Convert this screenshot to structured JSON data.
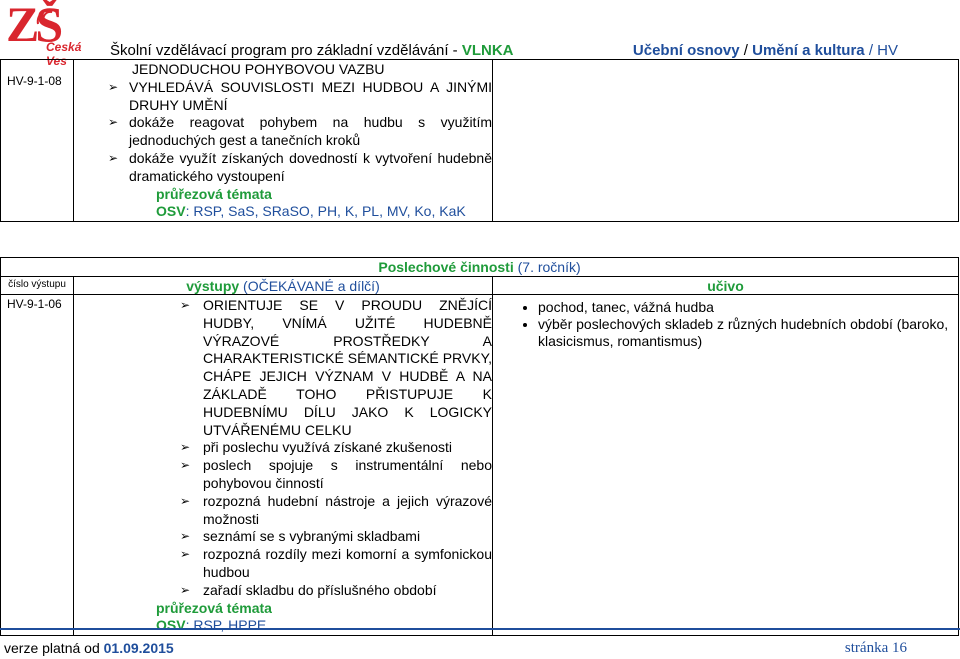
{
  "header": {
    "logo_text": "ZŠ",
    "logo_sub": "Česká Ves",
    "program_label": "Školní vzdělávací program pro základní vzdělávání - ",
    "program_name": "VLNKA",
    "curriculum_a": "Učební osnovy",
    "sep1": " / ",
    "curriculum_b": "Umění a kultura",
    "sep2": " / HV"
  },
  "table1": {
    "code": "HV-9-1-08",
    "lines": [
      "JEDNODUCHOU POHYBOVOU VAZBU"
    ],
    "bullets": [
      "VYHLEDÁVÁ SOUVISLOSTI MEZI HUDBOU A JINÝMI DRUHY UMĚNÍ",
      "dokáže reagovat pohybem na hudbu s využitím jednoduchých gest a tanečních kroků",
      "dokáže využít získaných dovedností k vytvoření hudebně dramatického vystoupení"
    ],
    "cross_title": "průřezová témata",
    "osv_label": "OSV",
    "osv_text": ": RSP, SaS, SRaSO, PH, K, PL, MV, Ko, KaK"
  },
  "table2": {
    "section_title": "Poslechové činnosti",
    "section_year": " (7. ročník)",
    "col_code": "číslo výstupu",
    "col_outputs_a": "výstupy",
    "col_outputs_b": " (OČEKÁVANÉ a dílčí)",
    "col_content": "učivo",
    "code": "HV-9-1-06",
    "bullets": [
      "ORIENTUJE SE V PROUDU ZNĚJÍCÍ HUDBY, VNÍMÁ UŽITÉ HUDEBNĚ VÝRAZOVÉ PROSTŘEDKY A CHARAKTERISTICKÉ SÉMANTICKÉ PRVKY, CHÁPE JEJICH VÝZNAM V HUDBĚ A NA ZÁKLADĚ TOHO PŘISTUPUJE K HUDEBNÍMU DÍLU JAKO K LOGICKY UTVÁŘENÉMU CELKU",
      "při poslechu využívá získané zkušenosti",
      "poslech spojuje s instrumentální nebo pohybovou činností",
      "rozpozná hudební nástroje a jejich výrazové možnosti",
      "seznámí se s vybranými skladbami",
      "rozpozná rozdíly mezi komorní a symfonickou hudbou",
      "zařadí skladbu do příslušného období"
    ],
    "cross_title": "průřezová témata",
    "osv_label": "OSV",
    "osv_text": ": RSP, HPPE",
    "content_items": [
      "pochod, tanec, vážná hudba",
      "výběr poslechových skladeb z různých hudebních období (baroko, klasicismus, romantismus)"
    ]
  },
  "footer": {
    "valid_label": "verze platná od ",
    "valid_date": "01.09.2015",
    "page": "stránka 16"
  }
}
